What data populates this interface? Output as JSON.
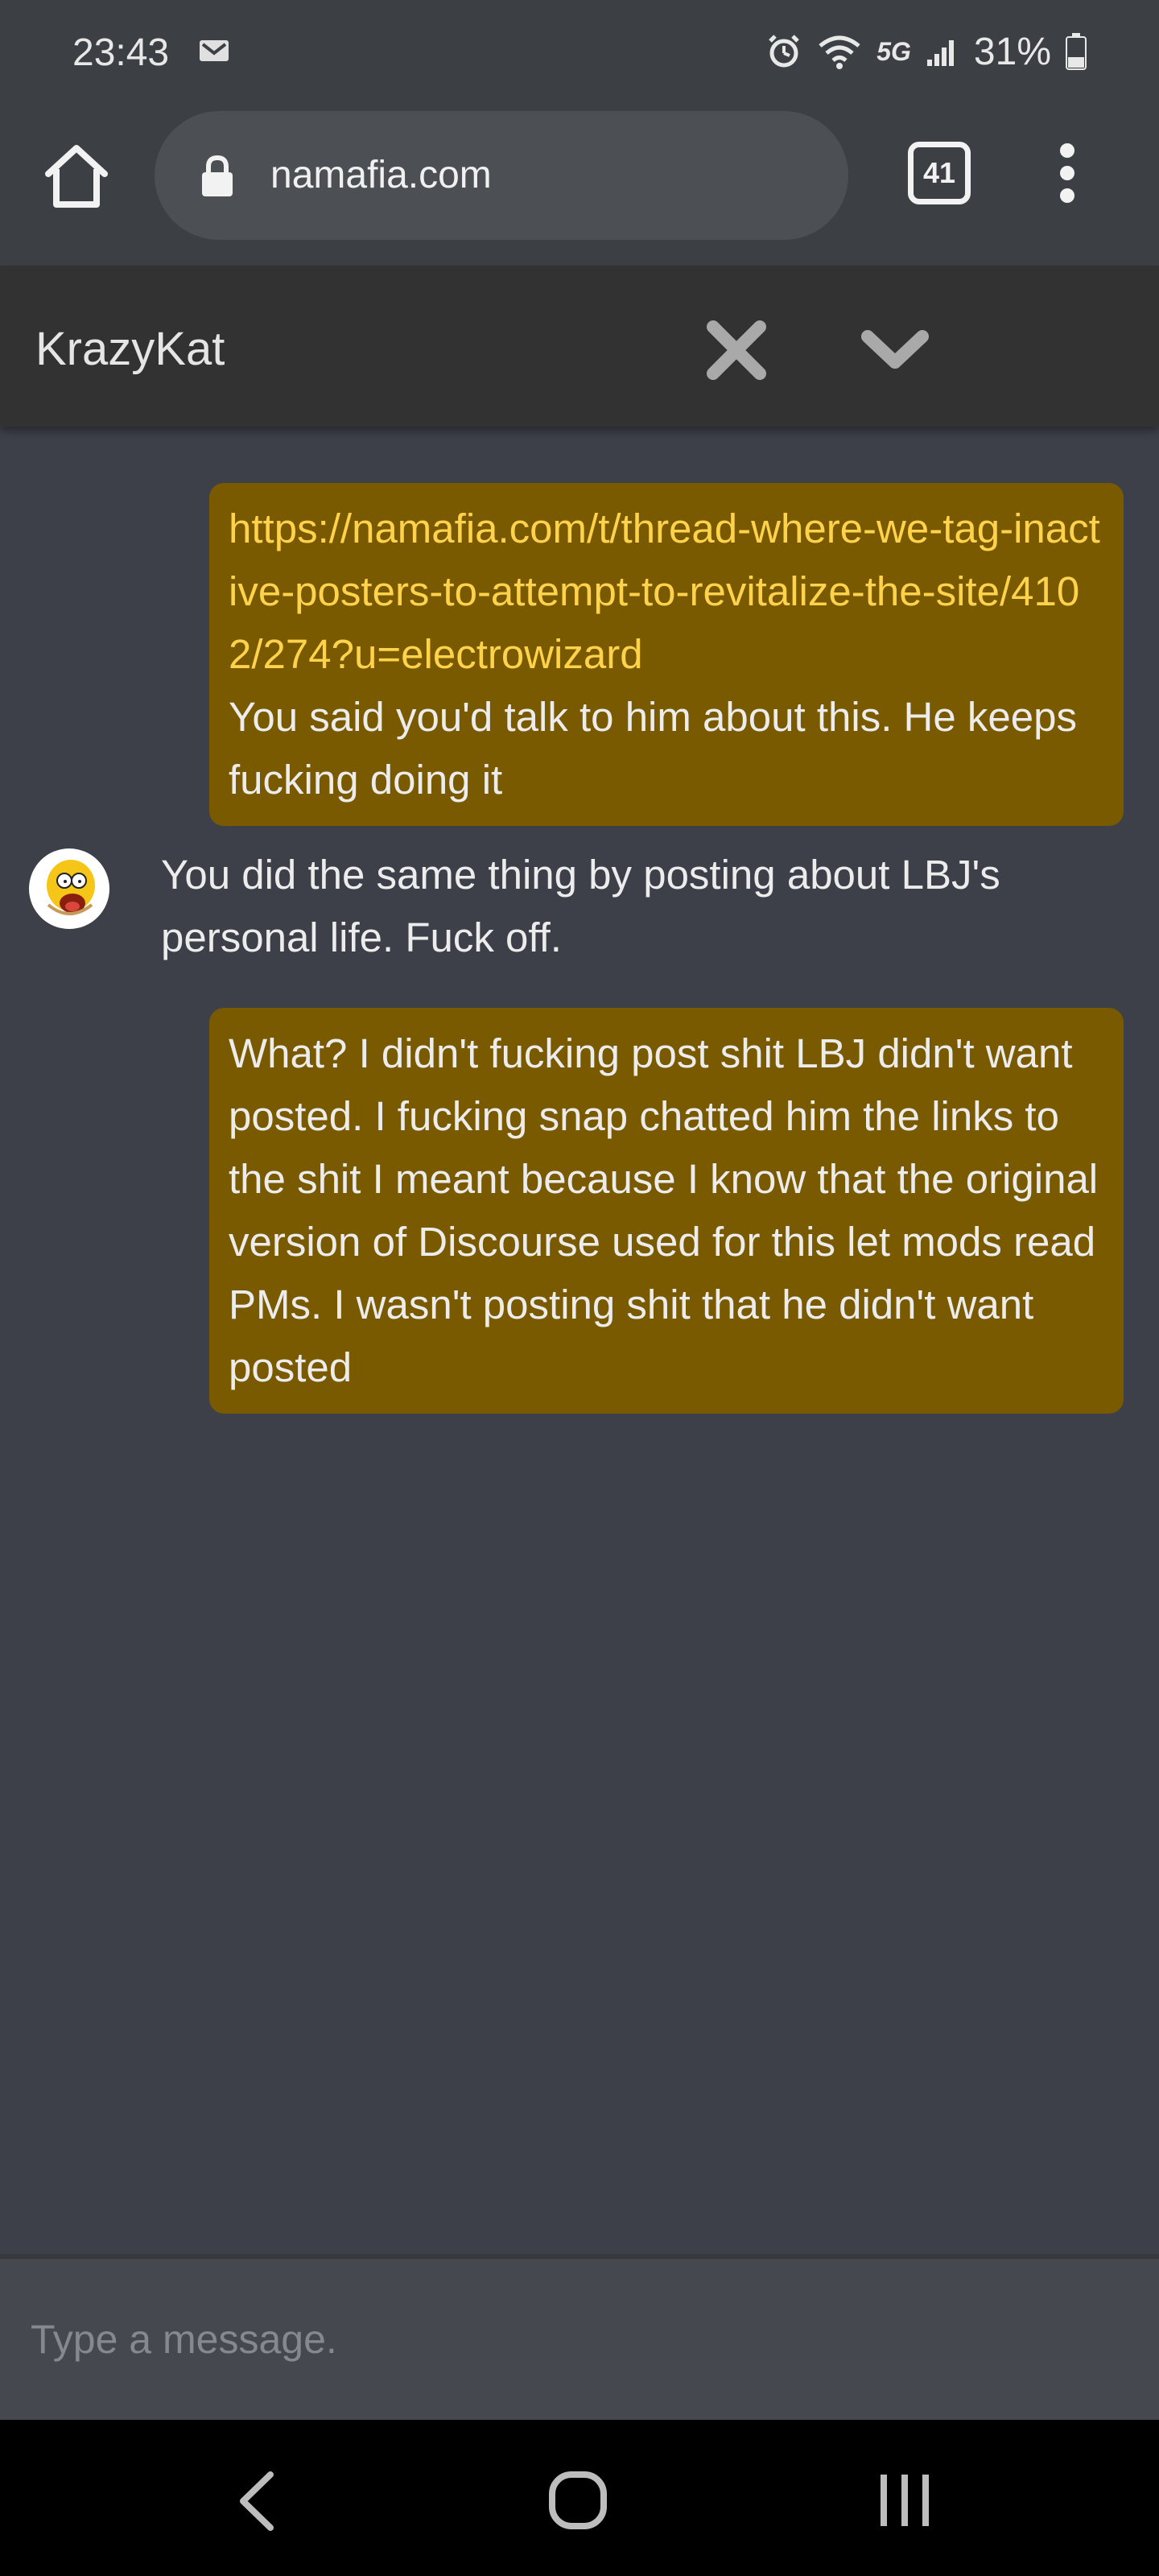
{
  "status_bar": {
    "time": "23:43",
    "network": "5G",
    "battery": "31%"
  },
  "browser": {
    "url": "namafia.com",
    "tab_count": "41"
  },
  "chat": {
    "title": "KrazyKat",
    "messages": [
      {
        "direction": "outgoing",
        "link": "https://namafia.com/t/thread-where-we-tag-inactive-posters-to-attempt-to-revitalize-the-site/4102/274?u=electrowizard",
        "text": "You said you'd talk to him about this. He keeps fucking doing it"
      },
      {
        "direction": "incoming",
        "text": "You did the same thing by posting about LBJ's personal life. Fuck off."
      },
      {
        "direction": "outgoing",
        "text": "What? I didn't fucking post shit LBJ didn't want posted. I fucking snap chatted him the links to the shit I meant because I know that the original version of Discourse used for this let mods read PMs. I wasn't posting shit that he didn't want posted"
      }
    ],
    "composer_placeholder": "Type a message."
  },
  "colors": {
    "background": "#3d4049",
    "outgoing_bubble": "#7a5a00",
    "link": "#ffd24c",
    "header": "#323232"
  }
}
